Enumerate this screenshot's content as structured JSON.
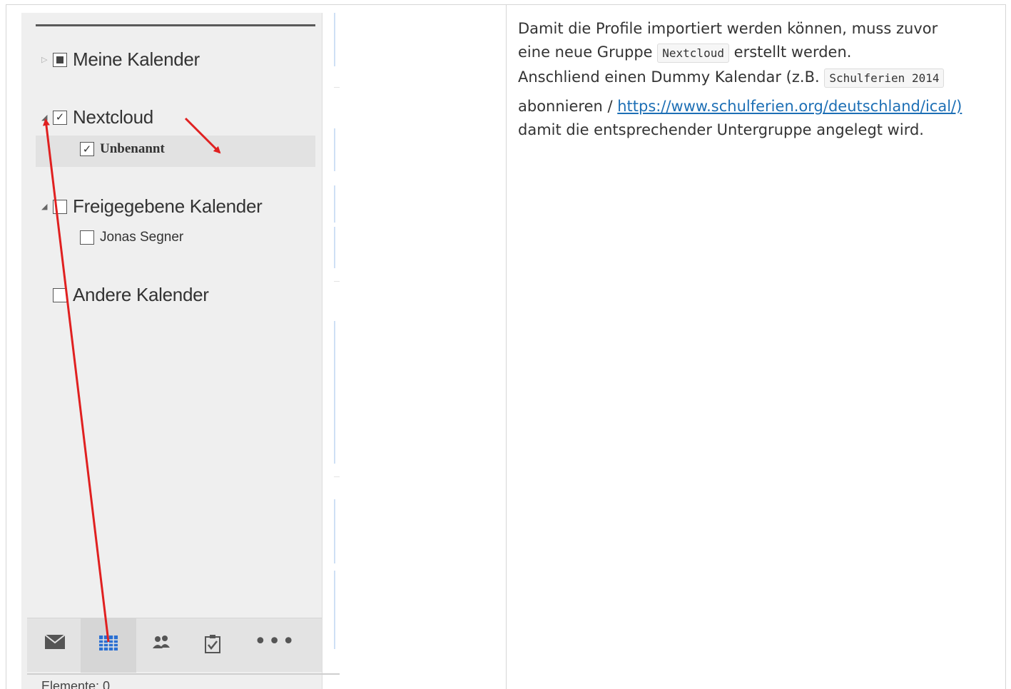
{
  "calendar_pane": {
    "groups": [
      {
        "label": "Meine Kalender",
        "expanded": false,
        "state": "partial"
      },
      {
        "label": "Nextcloud",
        "expanded": true,
        "state": "checked",
        "items": [
          {
            "label": "Unbenannt",
            "checked": true,
            "selected": true
          }
        ]
      },
      {
        "label": "Freigegebene Kalender",
        "expanded": true,
        "state": "unchecked",
        "items": [
          {
            "label": "Jonas Segner",
            "checked": false
          }
        ]
      },
      {
        "label": "Andere Kalender",
        "expanded": false,
        "state": "unchecked"
      }
    ],
    "bottom_nav": [
      {
        "icon": "mail-icon",
        "active": false
      },
      {
        "icon": "calendar-icon",
        "active": true
      },
      {
        "icon": "people-icon",
        "active": false
      },
      {
        "icon": "tasks-icon",
        "active": false
      },
      {
        "icon": "more-icon",
        "active": false
      }
    ],
    "below_nav_text": "Elemente: 0",
    "annotation_color": "#e02020"
  },
  "instructions": {
    "line1": "Damit die Profile importiert werden können, muss zuvor",
    "line2_before": "eine neue Gruppe ",
    "group_code": "Nextcloud",
    "line2_after": " erstellt werden.",
    "line3_before": "Anschliend einen Dummy Kalendar (z.B. ",
    "example_code": "Schulferien 2014",
    "line4_before": "abonnieren / ",
    "ical_link": "https://www.schulferien.org/deutschland/ical/)",
    "line5": "damit die entsprechender Untergruppe angelegt wird."
  }
}
